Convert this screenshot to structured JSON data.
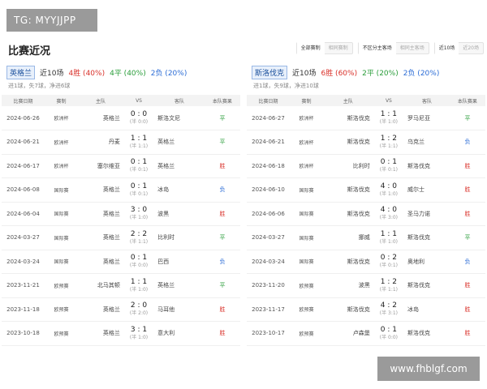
{
  "watermark_top": "TG: MYYJJPP",
  "watermark_bottom": "www.fhblgf.com",
  "section_title": "比赛近况",
  "filters": {
    "group1": [
      "全部赛制",
      "相同赛制"
    ],
    "group2": [
      "不区分主客场",
      "相同主客场"
    ],
    "group3": [
      "近10场",
      "近20场"
    ]
  },
  "columns": [
    "比赛日期",
    "赛制",
    "主队",
    "VS",
    "客队",
    "本队赛果"
  ],
  "colors": {
    "win": "#d9312a",
    "draw": "#2a9d3a",
    "loss": "#2c6dd6",
    "team_tag_bg": "#e8f0fb"
  },
  "left": {
    "team": "英格兰",
    "total": "近10场",
    "wins": "4胜 (40%)",
    "draws": "4平 (40%)",
    "losses": "2负 (20%)",
    "goals": "进1球，失7球，净进6球",
    "matches": [
      {
        "date": "2024-06-26",
        "comp": "欧洲杯",
        "home": "英格兰",
        "score": "0 : 0",
        "half": "(半 0:0)",
        "away": "斯洛文尼",
        "result": "平",
        "type": "draw"
      },
      {
        "date": "2024-06-21",
        "comp": "欧洲杯",
        "home": "丹麦",
        "score": "1 : 1",
        "half": "(半 1:1)",
        "away": "英格兰",
        "result": "平",
        "type": "draw"
      },
      {
        "date": "2024-06-17",
        "comp": "欧洲杯",
        "home": "塞尔维亚",
        "score": "0 : 1",
        "half": "(半 0:1)",
        "away": "英格兰",
        "result": "胜",
        "type": "win"
      },
      {
        "date": "2024-06-08",
        "comp": "国际赛",
        "home": "英格兰",
        "score": "0 : 1",
        "half": "(半 0:1)",
        "away": "冰岛",
        "result": "负",
        "type": "loss"
      },
      {
        "date": "2024-06-04",
        "comp": "国际赛",
        "home": "英格兰",
        "score": "3 : 0",
        "half": "(半 1:0)",
        "away": "波黑",
        "result": "胜",
        "type": "win"
      },
      {
        "date": "2024-03-27",
        "comp": "国际赛",
        "home": "英格兰",
        "score": "2 : 2",
        "half": "(半 1:1)",
        "away": "比利时",
        "result": "平",
        "type": "draw"
      },
      {
        "date": "2024-03-24",
        "comp": "国际赛",
        "home": "英格兰",
        "score": "0 : 1",
        "half": "(半 0:0)",
        "away": "巴西",
        "result": "负",
        "type": "loss"
      },
      {
        "date": "2023-11-21",
        "comp": "欧预赛",
        "home": "北马其顿",
        "score": "1 : 1",
        "half": "(半 1:0)",
        "away": "英格兰",
        "result": "平",
        "type": "draw"
      },
      {
        "date": "2023-11-18",
        "comp": "欧预赛",
        "home": "英格兰",
        "score": "2 : 0",
        "half": "(半 2:0)",
        "away": "马耳他",
        "result": "胜",
        "type": "win"
      },
      {
        "date": "2023-10-18",
        "comp": "欧预赛",
        "home": "英格兰",
        "score": "3 : 1",
        "half": "(半 1:0)",
        "away": "意大利",
        "result": "胜",
        "type": "win"
      }
    ]
  },
  "right": {
    "team": "斯洛伐克",
    "total": "近10场",
    "wins": "6胜 (60%)",
    "draws": "2平 (20%)",
    "losses": "2负 (20%)",
    "goals": "进1球，失9球，净进10球",
    "matches": [
      {
        "date": "2024-06-27",
        "comp": "欧洲杯",
        "home": "斯洛伐克",
        "score": "1 : 1",
        "half": "(半 1:0)",
        "away": "罗马尼亚",
        "result": "平",
        "type": "draw"
      },
      {
        "date": "2024-06-21",
        "comp": "欧洲杯",
        "home": "斯洛伐克",
        "score": "1 : 2",
        "half": "(半 1:1)",
        "away": "乌克兰",
        "result": "负",
        "type": "loss"
      },
      {
        "date": "2024-06-18",
        "comp": "欧洲杯",
        "home": "比利时",
        "score": "0 : 1",
        "half": "(半 0:1)",
        "away": "斯洛伐克",
        "result": "胜",
        "type": "win"
      },
      {
        "date": "2024-06-10",
        "comp": "国际赛",
        "home": "斯洛伐克",
        "score": "4 : 0",
        "half": "(半 1:0)",
        "away": "威尔士",
        "result": "胜",
        "type": "win"
      },
      {
        "date": "2024-06-06",
        "comp": "国际赛",
        "home": "斯洛伐克",
        "score": "4 : 0",
        "half": "(半 3:0)",
        "away": "圣马力诺",
        "result": "胜",
        "type": "win"
      },
      {
        "date": "2024-03-27",
        "comp": "国际赛",
        "home": "挪威",
        "score": "1 : 1",
        "half": "(半 1:0)",
        "away": "斯洛伐克",
        "result": "平",
        "type": "draw"
      },
      {
        "date": "2024-03-24",
        "comp": "国际赛",
        "home": "斯洛伐克",
        "score": "0 : 2",
        "half": "(半 0:1)",
        "away": "奥地利",
        "result": "负",
        "type": "loss"
      },
      {
        "date": "2023-11-20",
        "comp": "欧预赛",
        "home": "波黑",
        "score": "1 : 2",
        "half": "(半 1:1)",
        "away": "斯洛伐克",
        "result": "胜",
        "type": "win"
      },
      {
        "date": "2023-11-17",
        "comp": "欧预赛",
        "home": "斯洛伐克",
        "score": "4 : 2",
        "half": "(半 3:1)",
        "away": "冰岛",
        "result": "胜",
        "type": "win"
      },
      {
        "date": "2023-10-17",
        "comp": "欧预赛",
        "home": "卢森堡",
        "score": "0 : 1",
        "half": "(半 0:0)",
        "away": "斯洛伐克",
        "result": "胜",
        "type": "win"
      }
    ]
  }
}
